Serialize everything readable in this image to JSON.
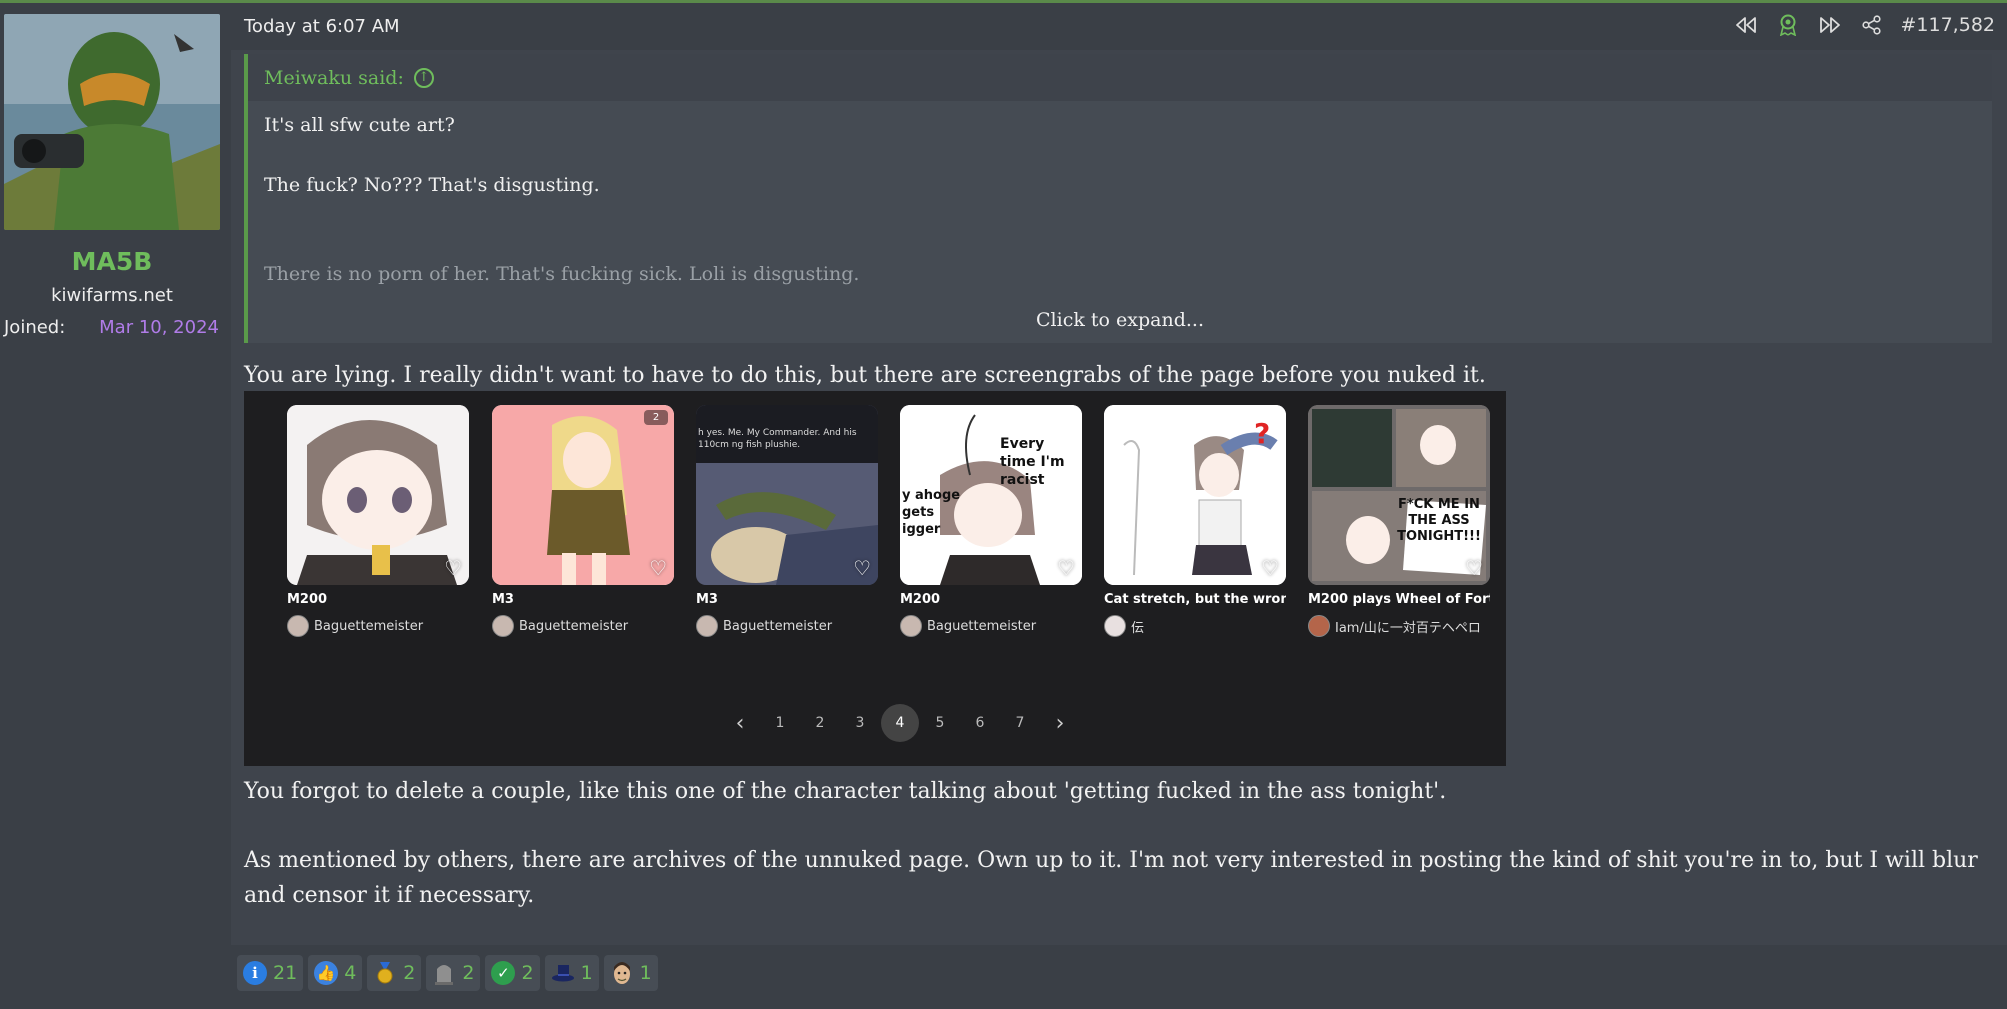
{
  "user": {
    "name": "MA5B",
    "title": "kiwifarms.net",
    "joined_label": "Joined:",
    "joined_date": "Mar 10, 2024"
  },
  "post": {
    "date": "Today at 6:07 AM",
    "number": "#117,582"
  },
  "quote": {
    "author_label": "Meiwaku said:",
    "lines": [
      "It's all sfw cute art?",
      "The fuck? No??? That's disgusting.",
      "There is no porn of her. That's fucking sick. Loli is disgusting."
    ],
    "expand_label": "Click to expand..."
  },
  "body": {
    "p1": "You are lying. I really didn't want to have to do this, but there are screengrabs of the page before you nuked it.",
    "p2": "You forgot to delete a couple, like this one of the character talking about 'getting fucked in the ass tonight'.",
    "p3a": "As mentioned by others, there are archives of the unnuked page. Own up to it. I'm not very interested in posting the kind of shit you're in to, but I will blur",
    "p3b": "and censor it if necessary."
  },
  "screenshot": {
    "cards": [
      {
        "title": "M200",
        "author": "Baguettemeister",
        "badge": "",
        "caption": ""
      },
      {
        "title": "M3",
        "author": "Baguettemeister",
        "badge": "2",
        "caption": ""
      },
      {
        "title": "M3",
        "author": "Baguettemeister",
        "badge": "",
        "caption": "h yes. Me. My Commander. And his 110cm ng fish plushie."
      },
      {
        "title": "M200",
        "author": "Baguettemeister",
        "badge": "",
        "caption": "Every time I'm racist"
      },
      {
        "title": "Cat stretch, but the wron...",
        "author": "伝",
        "badge": "",
        "caption": ""
      },
      {
        "title": "M200 plays Wheel of Fort...",
        "author": "Iam/山に一対百テヘペロ",
        "badge": "",
        "caption": "F*CK ME IN THE ASS TONIGHT!!!"
      }
    ],
    "pages": [
      "1",
      "2",
      "3",
      "4",
      "5",
      "6",
      "7"
    ],
    "current_page": "4",
    "extra_caption": "y ahoge gets igger"
  },
  "reactions": [
    {
      "icon": "informative-icon",
      "count": "21",
      "color": "#2a7de1"
    },
    {
      "icon": "like-icon",
      "count": "4",
      "color": "#3b82e0"
    },
    {
      "icon": "medal-icon",
      "count": "2",
      "color": "#d4a017"
    },
    {
      "icon": "tombstone-icon",
      "count": "2",
      "color": "#8a8a8a"
    },
    {
      "icon": "check-icon",
      "count": "2",
      "color": "#2e9e4e"
    },
    {
      "icon": "top-hat-icon",
      "count": "1",
      "color": "#1d2a6a"
    },
    {
      "icon": "face-icon",
      "count": "1",
      "color": "#c9a074"
    }
  ],
  "colors": {
    "accent_green": "#6fbd5c",
    "joined_purple": "#b07ce8",
    "background": "#3f444c"
  }
}
